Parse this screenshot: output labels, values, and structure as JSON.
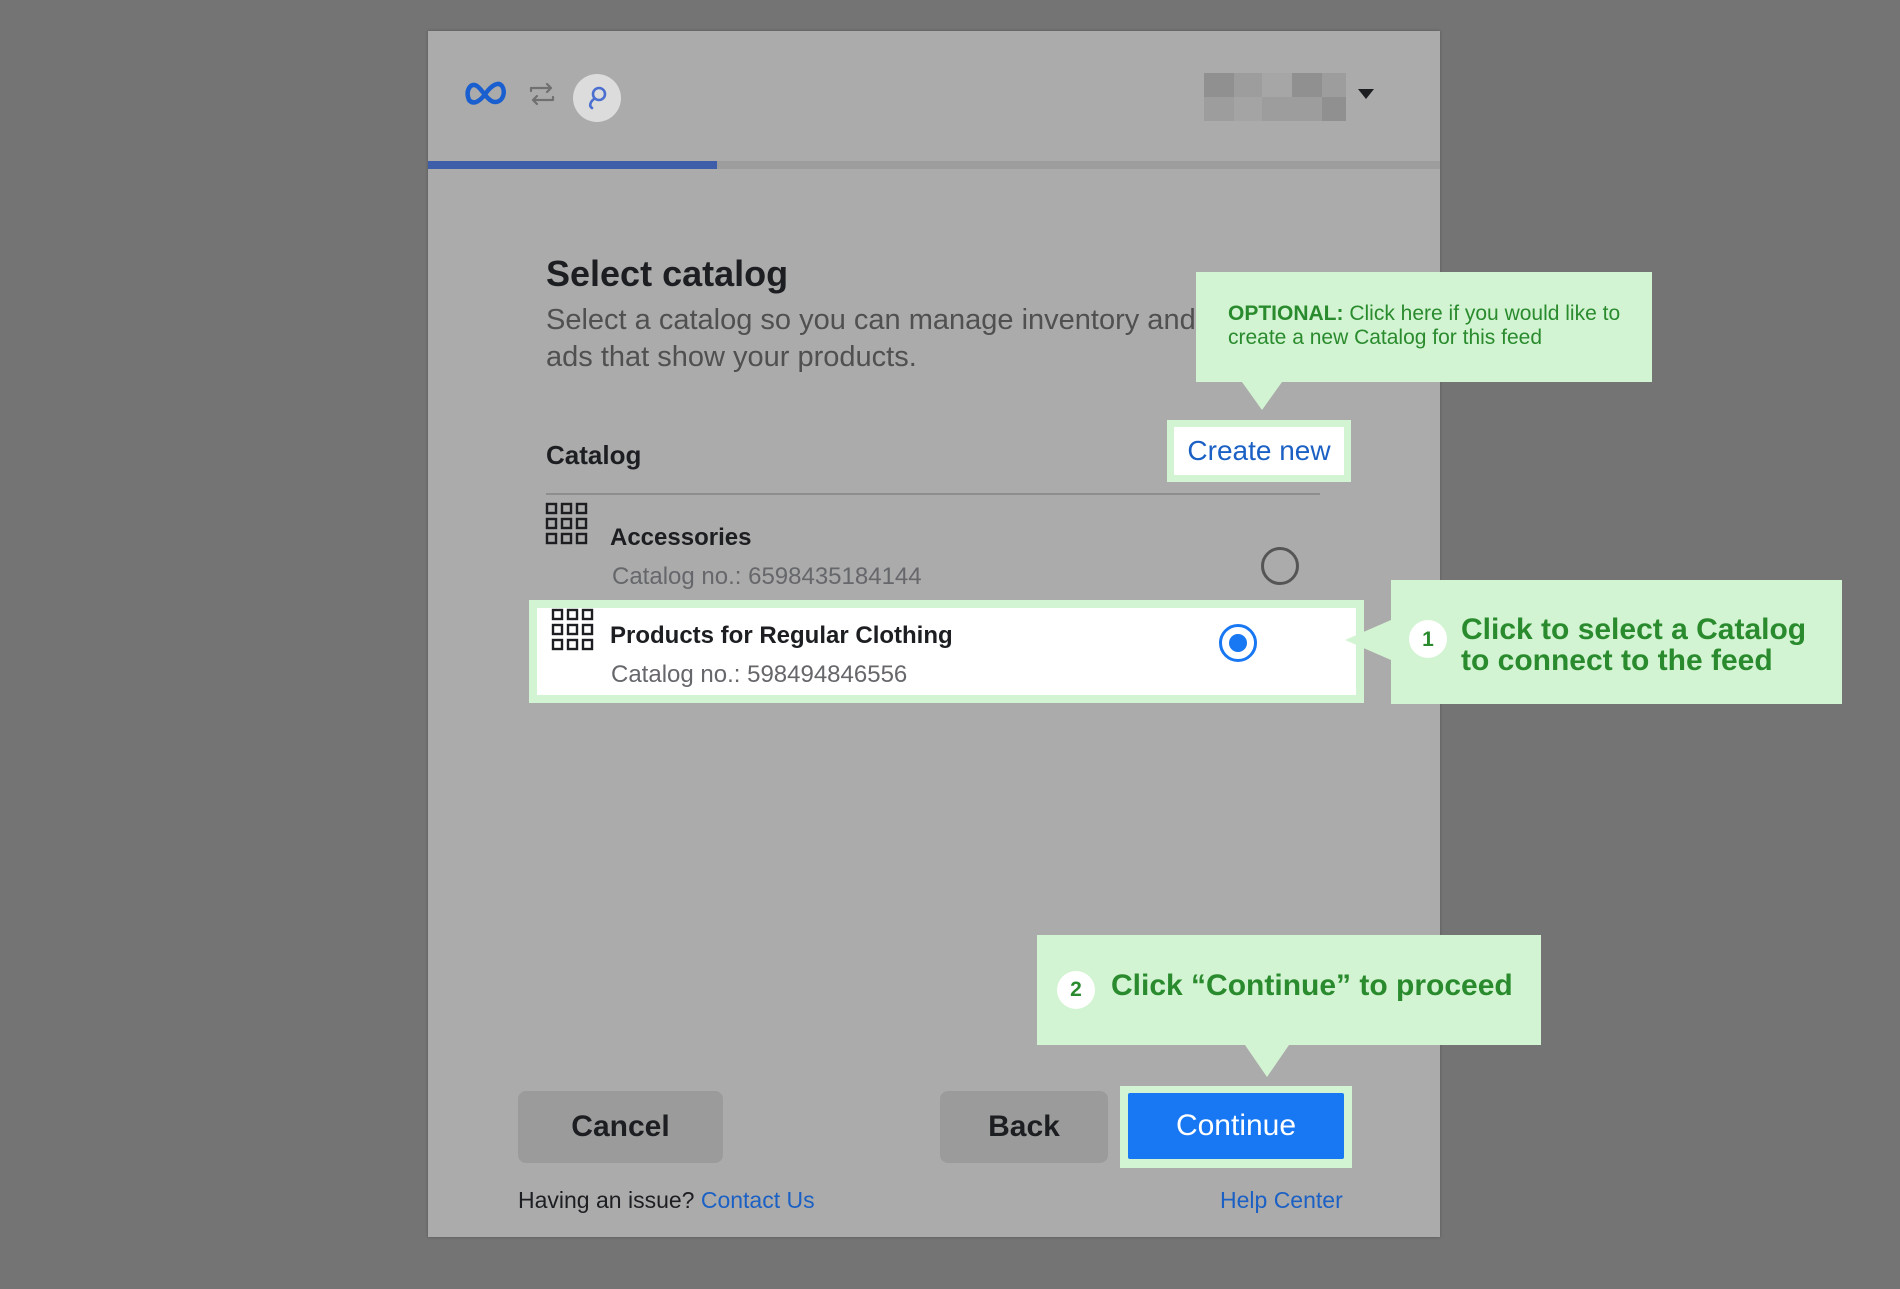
{
  "header": {
    "logo_icon": "meta-logo-icon",
    "swap_icon": "swap-arrows-icon",
    "app_icon": "integration-app-icon",
    "account_caret_icon": "caret-down-icon",
    "progress_fraction": 0.286,
    "progress_color": "#3e5ea9"
  },
  "main": {
    "title": "Select catalog",
    "subtitle": "Select a catalog so you can manage inventory and deliver ads that show your products.",
    "section_label": "Catalog",
    "create_new_label": "Create new",
    "catalogs": [
      {
        "name": "Accessories",
        "number_text": "Catalog no.: 6598435184144",
        "selected": false
      },
      {
        "name": "Products for Regular Clothing",
        "number_text": "Catalog no.: 598494846556",
        "selected": true
      }
    ]
  },
  "buttons": {
    "cancel_label": "Cancel",
    "back_label": "Back",
    "continue_label": "Continue"
  },
  "footer": {
    "issue_text": "Having an issue?",
    "contact_link": "Contact Us",
    "help_link": "Help Center"
  },
  "callouts": {
    "optional": {
      "prefix": "OPTIONAL:",
      "text": "Click here if you would like to create a new Catalog for this feed"
    },
    "step1": {
      "number": "1",
      "text": "Click to select a Catalog to connect to the feed"
    },
    "step2": {
      "number": "2",
      "text_before": "Click “",
      "emphasis": "Continue",
      "text_after": "” to proceed"
    }
  },
  "colors": {
    "accent": "#1877f2",
    "link": "#1b60c4",
    "callout_bg": "#d3f4d2",
    "callout_text": "#2a8b2e"
  }
}
